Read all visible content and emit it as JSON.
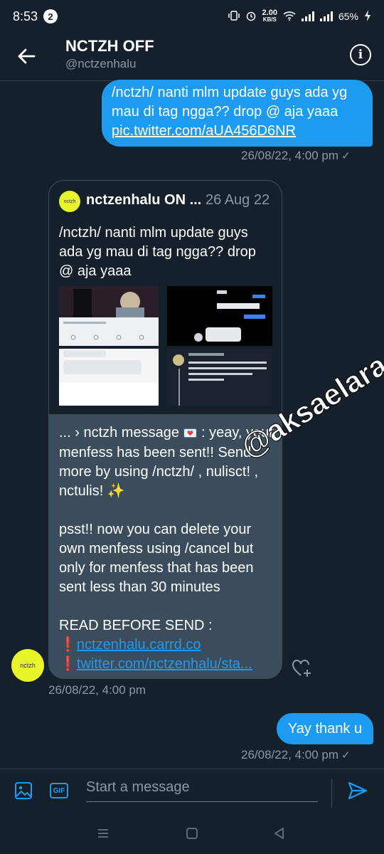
{
  "status_bar": {
    "time": "8:53",
    "notification_count": "2",
    "speed_value": "2.00",
    "speed_unit": "KB/S",
    "battery": "65%"
  },
  "header": {
    "title": "NCTZH OFF",
    "handle": "@nctzenhalu"
  },
  "messages": {
    "m1": {
      "lines": [
        "/nctzh/ nanti mlm update guys ada yg",
        "mau di tag ngga?? drop @ aja yaaa"
      ],
      "link": "pic.twitter.com/aUA456D6NR",
      "timestamp": "26/08/22, 4:00 pm"
    },
    "m2": {
      "quote_name": "nctzenhalu ON ...",
      "quote_date": "26 Aug 22",
      "quote_text": "/nctzh/ nanti mlm update guys ada yg mau di tag ngga?? drop @ aja yaaa",
      "avatar_text": "nctzh",
      "p1_a": "... › nctzh message ",
      "p1_b": " : yeay, your menfess has been sent!! Send more by using /nctzh/ , nulisct! , nctulis! ",
      "p2": "psst!! now you can delete your own menfess using /cancel but only for menfess that has been sent less than 30 minutes",
      "p3": "READ BEFORE SEND :",
      "link1": "nctzenhalu.carrd.co",
      "link2": "twitter.com/nctzenhalu/sta...",
      "timestamp": "26/08/22, 4:00 pm"
    },
    "m3": {
      "text": "Yay thank u",
      "timestamp": "26/08/22, 4:00 pm"
    }
  },
  "watermark": "@aksaelara",
  "composer": {
    "placeholder": "Start a message",
    "gif_label": "GIF"
  },
  "colors": {
    "background": "#15202b",
    "accent": "#1d9bf0",
    "card": "#3b4d5c",
    "avatar": "#e7f52a"
  }
}
